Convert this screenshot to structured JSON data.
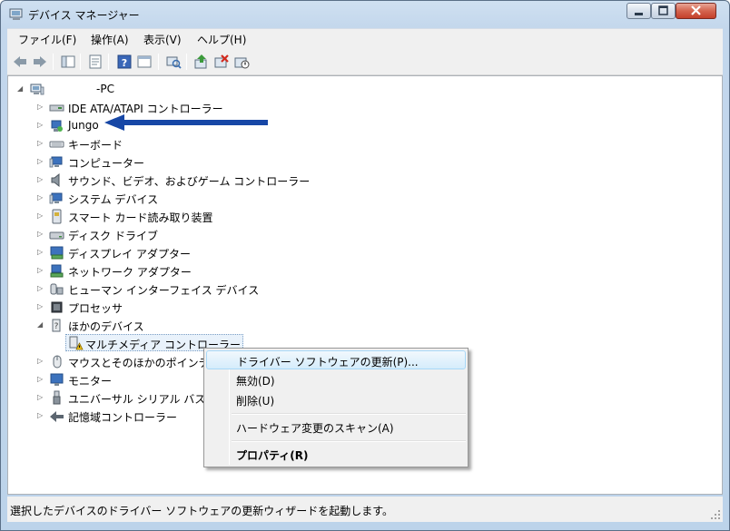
{
  "window": {
    "title": "デバイス マネージャー"
  },
  "menu": [
    "ファイル(F)",
    "操作(A)",
    "表示(V)",
    "ヘルプ(H)"
  ],
  "toolbar_icons": [
    "back-icon",
    "forward-icon",
    "show-hide-tree-icon",
    "properties-icon",
    "help-icon",
    "view-icon",
    "scan-hardware-icon",
    "update-driver-icon",
    "uninstall-icon",
    "disable-icon"
  ],
  "tree": {
    "root": "-PC",
    "items": [
      "IDE ATA/ATAPI コントローラー",
      "Jungo",
      "キーボード",
      "コンピューター",
      "サウンド、ビデオ、およびゲーム コントローラー",
      "システム デバイス",
      "スマート カード読み取り装置",
      "ディスク ドライブ",
      "ディスプレイ アダプター",
      "ネットワーク アダプター",
      "ヒューマン インターフェイス デバイス",
      "プロセッサ",
      "ほかのデバイス",
      "マルチメディア コントローラー",
      "マウスとそのほかのポインティング デバイス",
      "モニター",
      "ユニバーサル シリアル バス コントローラー",
      "記憶域コントローラー"
    ]
  },
  "context_menu": {
    "update": "ドライバー ソフトウェアの更新(P)...",
    "disable": "無効(D)",
    "uninstall": "削除(U)",
    "scan": "ハードウェア変更のスキャン(A)",
    "properties": "プロパティ(R)"
  },
  "status": "選択したデバイスのドライバー ソフトウェアの更新ウィザードを起動します。",
  "colors": {
    "arrow": "#1747a6",
    "highlight": "#d5ecfb",
    "warning": "#f0c419"
  }
}
